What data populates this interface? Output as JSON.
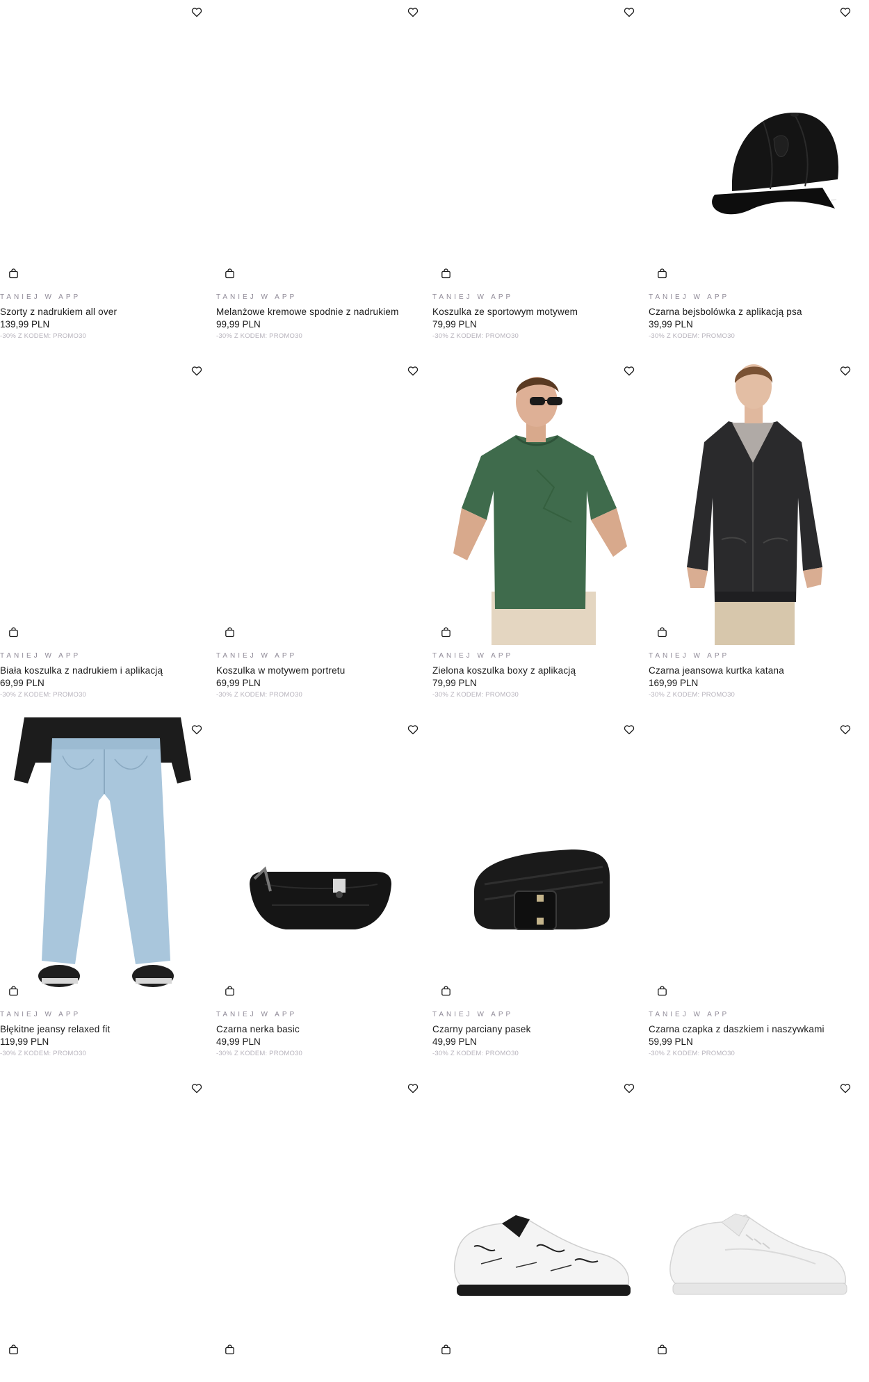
{
  "icons": {
    "wishlist": "heart-icon",
    "bag": "shopping-bag-icon"
  },
  "products": [
    {
      "promo": "TANIEJ W APP",
      "name": "Szorty z nadrukiem all over",
      "price": "139,99 PLN",
      "code": "-30% Z KODEM: PROMO30",
      "image": "none"
    },
    {
      "promo": "TANIEJ W APP",
      "name": "Melanżowe kremowe spodnie z nadrukiem",
      "price": "99,99 PLN",
      "code": "-30% Z KODEM: PROMO30",
      "image": "none"
    },
    {
      "promo": "TANIEJ W APP",
      "name": "Koszulka ze sportowym motywem",
      "price": "79,99 PLN",
      "code": "-30% Z KODEM: PROMO30",
      "image": "none"
    },
    {
      "promo": "TANIEJ W APP",
      "name": "Czarna bejsbolówka z aplikacją psa",
      "price": "39,99 PLN",
      "code": "-30% Z KODEM: PROMO30",
      "image": "cap"
    },
    {
      "promo": "TANIEJ W APP",
      "name": "Biała koszulka z nadrukiem i aplikacją",
      "price": "69,99 PLN",
      "code": "-30% Z KODEM: PROMO30",
      "image": "none"
    },
    {
      "promo": "TANIEJ W APP",
      "name": "Koszulka w motywem portretu",
      "price": "69,99 PLN",
      "code": "-30% Z KODEM: PROMO30",
      "image": "none"
    },
    {
      "promo": "TANIEJ W APP",
      "name": "Zielona koszulka boxy z aplikacją",
      "price": "79,99 PLN",
      "code": "-30% Z KODEM: PROMO30",
      "image": "green-tee"
    },
    {
      "promo": "TANIEJ W APP",
      "name": "Czarna jeansowa kurtka katana",
      "price": "169,99 PLN",
      "code": "-30% Z KODEM: PROMO30",
      "image": "jacket"
    },
    {
      "promo": "TANIEJ W APP",
      "name": "Błękitne jeansy relaxed fit",
      "price": "119,99 PLN",
      "code": "-30% Z KODEM: PROMO30",
      "image": "jeans"
    },
    {
      "promo": "TANIEJ W APP",
      "name": "Czarna nerka basic",
      "price": "49,99 PLN",
      "code": "-30% Z KODEM: PROMO30",
      "image": "waist-bag"
    },
    {
      "promo": "TANIEJ W APP",
      "name": "Czarny parciany pasek",
      "price": "49,99 PLN",
      "code": "-30% Z KODEM: PROMO30",
      "image": "belt"
    },
    {
      "promo": "TANIEJ W APP",
      "name": "Czarna czapka z daszkiem i naszywkami",
      "price": "59,99 PLN",
      "code": "-30% Z KODEM: PROMO30",
      "image": "none"
    },
    {
      "promo": "",
      "name": "",
      "price": "",
      "code": "",
      "image": "none"
    },
    {
      "promo": "",
      "name": "",
      "price": "",
      "code": "",
      "image": "none"
    },
    {
      "promo": "",
      "name": "",
      "price": "",
      "code": "",
      "image": "sneaker-graffiti"
    },
    {
      "promo": "",
      "name": "",
      "price": "",
      "code": "",
      "image": "sneaker-white"
    }
  ]
}
